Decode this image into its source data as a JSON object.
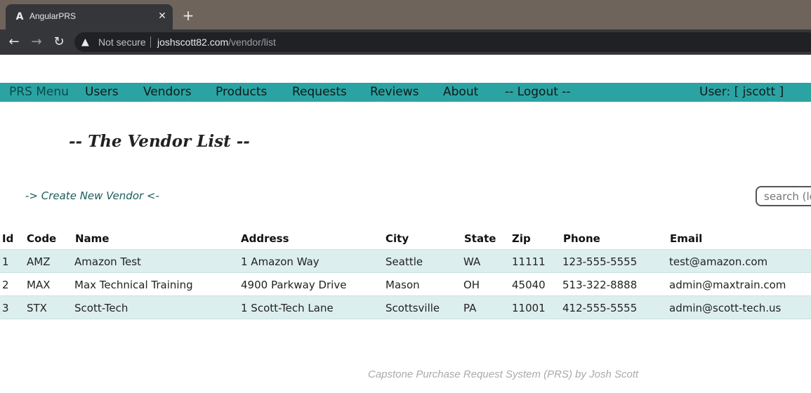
{
  "browser": {
    "tab_title": "AngularPRS",
    "tab_favicon": "A",
    "close_glyph": "✕",
    "new_tab_glyph": "+",
    "not_secure": "Not secure",
    "url_host": "joshscott82.com",
    "url_path": "/vendor/list",
    "icons": [
      "angular-favicon-icon",
      "close-icon",
      "plus-icon",
      "back-arrow-icon",
      "forward-arrow-icon",
      "reload-icon",
      "warning-icon"
    ]
  },
  "menu": {
    "brand": "PRS Menu",
    "items": [
      "Users",
      "Vendors",
      "Products",
      "Requests",
      "Reviews",
      "About",
      "-- Logout --"
    ],
    "user": "User: [ jscott ]"
  },
  "page": {
    "title": "-- The Vendor List --",
    "create_link": "-> Create New Vendor <-",
    "search_placeholder": "search (lo"
  },
  "table": {
    "headers": [
      "Id",
      "Code",
      "Name",
      "Address",
      "City",
      "State",
      "Zip",
      "Phone",
      "Email"
    ],
    "rows": [
      [
        "1",
        "AMZ",
        "Amazon Test",
        "1 Amazon Way",
        "Seattle",
        "WA",
        "11111",
        "123-555-5555",
        "test@amazon.com"
      ],
      [
        "2",
        "MAX",
        "Max Technical Training",
        "4900 Parkway Drive",
        "Mason",
        "OH",
        "45040",
        "513-322-8888",
        "admin@maxtrain.com"
      ],
      [
        "3",
        "STX",
        "Scott-Tech",
        "1 Scott-Tech Lane",
        "Scottsville",
        "PA",
        "11001",
        "412-555-5555",
        "admin@scott-tech.us"
      ]
    ]
  },
  "footer": {
    "text": "Capstone Purchase Request System (PRS) by Josh Scott"
  },
  "colors": {
    "menu_bg": "#2ba3a3",
    "row_shade": "#dcefee",
    "link": "#1a5c5c"
  }
}
